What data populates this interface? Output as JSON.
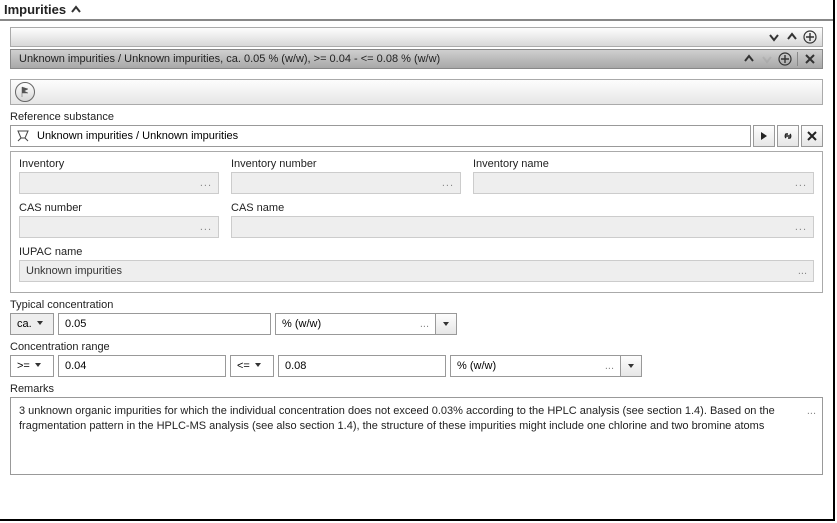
{
  "section": {
    "title": "Impurities"
  },
  "item": {
    "summary": "Unknown impurities / Unknown impurities, ca. 0.05 % (w/w), >= 0.04 - <= 0.08 % (w/w)"
  },
  "labels": {
    "ref_sub": "Reference substance",
    "inventory": "Inventory",
    "inv_number": "Inventory number",
    "inv_name": "Inventory name",
    "cas_number": "CAS number",
    "cas_name": "CAS name",
    "iupac": "IUPAC name",
    "typ_conc": "Typical concentration",
    "conc_range": "Concentration range",
    "remarks": "Remarks"
  },
  "ref_substance": {
    "value": "Unknown impurities / Unknown impurities"
  },
  "iupac_value": "Unknown impurities",
  "typical": {
    "qual": "ca.",
    "value": "0.05",
    "unit": "% (w/w)"
  },
  "range": {
    "lo_op": ">=",
    "lo_val": "0.04",
    "hi_op": "<=",
    "hi_val": "0.08",
    "unit": "% (w/w)"
  },
  "remarks": "3 unknown organic impurities for which the individual concentration does not exceed  0.03% according to the HPLC analysis (see section 1.4). Based on the fragmentation pattern in the HPLC-MS analysis (see also section 1.4), the structure of these impurities might include one chlorine and two bromine atoms"
}
